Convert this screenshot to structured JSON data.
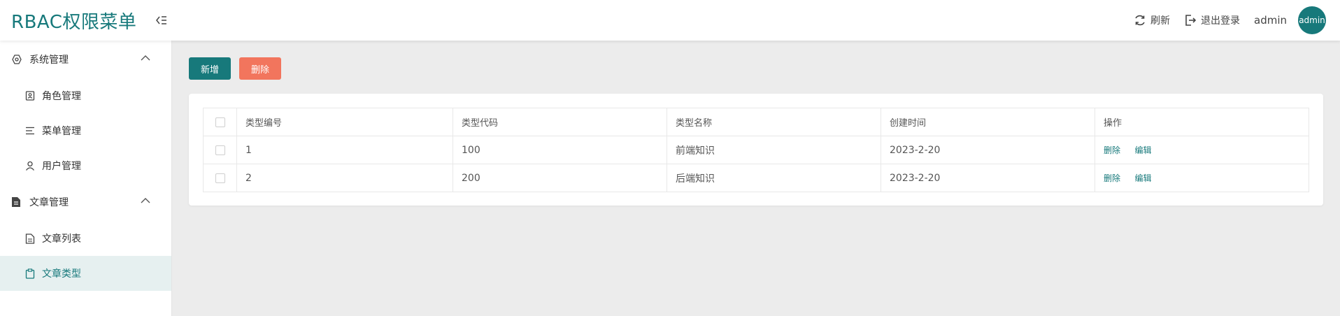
{
  "header": {
    "title": "RBAC权限菜单",
    "refresh_label": "刷新",
    "logout_label": "退出登录",
    "username": "admin",
    "avatar_text": "admin"
  },
  "sidebar": {
    "groups": [
      {
        "label": "系统管理",
        "icon": "settings-icon",
        "items": [
          {
            "label": "角色管理",
            "icon": "role-card-icon"
          },
          {
            "label": "菜单管理",
            "icon": "list-icon"
          },
          {
            "label": "用户管理",
            "icon": "user-icon"
          }
        ]
      },
      {
        "label": "文章管理",
        "icon": "document-icon",
        "items": [
          {
            "label": "文章列表",
            "icon": "document-outline-icon"
          },
          {
            "label": "文章类型",
            "icon": "clipboard-icon",
            "active": true
          }
        ]
      }
    ]
  },
  "toolbar": {
    "add_label": "新增",
    "delete_label": "删除"
  },
  "table": {
    "columns": [
      "类型编号",
      "类型代码",
      "类型名称",
      "创建时间",
      "操作"
    ],
    "rows": [
      {
        "id": "1",
        "code": "100",
        "name": "前端知识",
        "created": "2023-2-20",
        "delete": "删除",
        "edit": "编辑"
      },
      {
        "id": "2",
        "code": "200",
        "name": "后端知识",
        "created": "2023-2-20",
        "delete": "删除",
        "edit": "编辑"
      }
    ]
  },
  "colors": {
    "primary": "#17797b",
    "danger": "#f2755d",
    "active_bg": "#e6f0f0",
    "page_bg": "#ececec"
  }
}
